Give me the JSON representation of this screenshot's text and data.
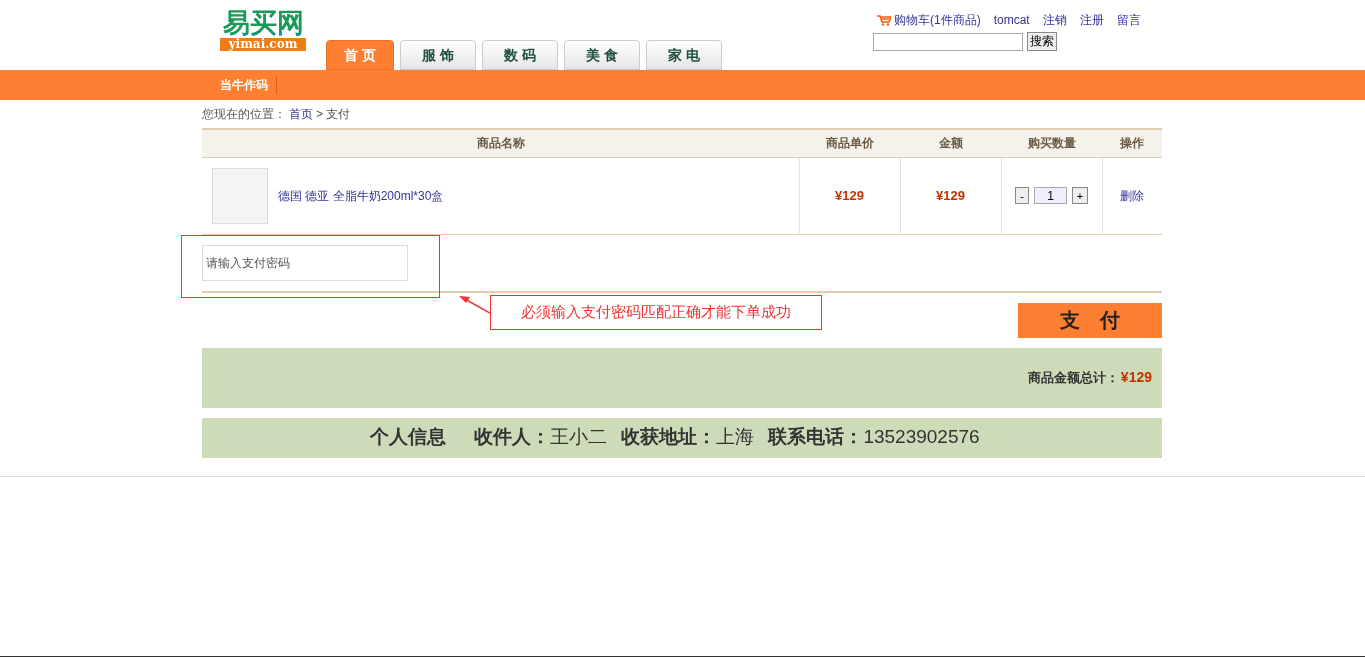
{
  "logo": {
    "title": "易买网",
    "domain": "yimai.com"
  },
  "top_links": [
    {
      "kind": "cart",
      "label": "购物车(1件商品)"
    },
    {
      "kind": "link",
      "label": "tomcat"
    },
    {
      "kind": "link",
      "label": "注销"
    },
    {
      "kind": "link",
      "label": "注册"
    },
    {
      "kind": "link",
      "label": "留言"
    }
  ],
  "search": {
    "button": "搜索"
  },
  "tabs": [
    {
      "label": "首 页",
      "selected": true
    },
    {
      "label": "服 饰",
      "selected": false
    },
    {
      "label": "数 码",
      "selected": false
    },
    {
      "label": "美 食",
      "selected": false
    },
    {
      "label": "家 电",
      "selected": false
    }
  ],
  "subnav": [
    "当牛作码"
  ],
  "breadcrumb": {
    "prefix": "您现在的位置：",
    "link": "首页",
    "separator": ">",
    "current": "支付"
  },
  "table": {
    "columns": [
      "商品名称",
      "商品单价",
      "金额",
      "购买数量",
      "操作"
    ],
    "rows": [
      {
        "name": "德国 德亚 全脂牛奶200ml*30盒",
        "price": "¥129",
        "amount": "¥129",
        "minus": "-",
        "quantity": "1",
        "plus": "+",
        "action": "删除"
      }
    ]
  },
  "password": {
    "placeholder": "请输入支付密码"
  },
  "annotation": "必须输入支付密码匹配正确才能下单成功",
  "pay_button": "支　付",
  "total": {
    "label": "商品金额总计：",
    "value": "¥129"
  },
  "info": {
    "heading": "个人信息",
    "fields": [
      {
        "label": "收件人：",
        "value": "王小二"
      },
      {
        "label": "收获地址：",
        "value": "上海"
      },
      {
        "label": "联系电话：",
        "value": "13523902576"
      }
    ]
  }
}
